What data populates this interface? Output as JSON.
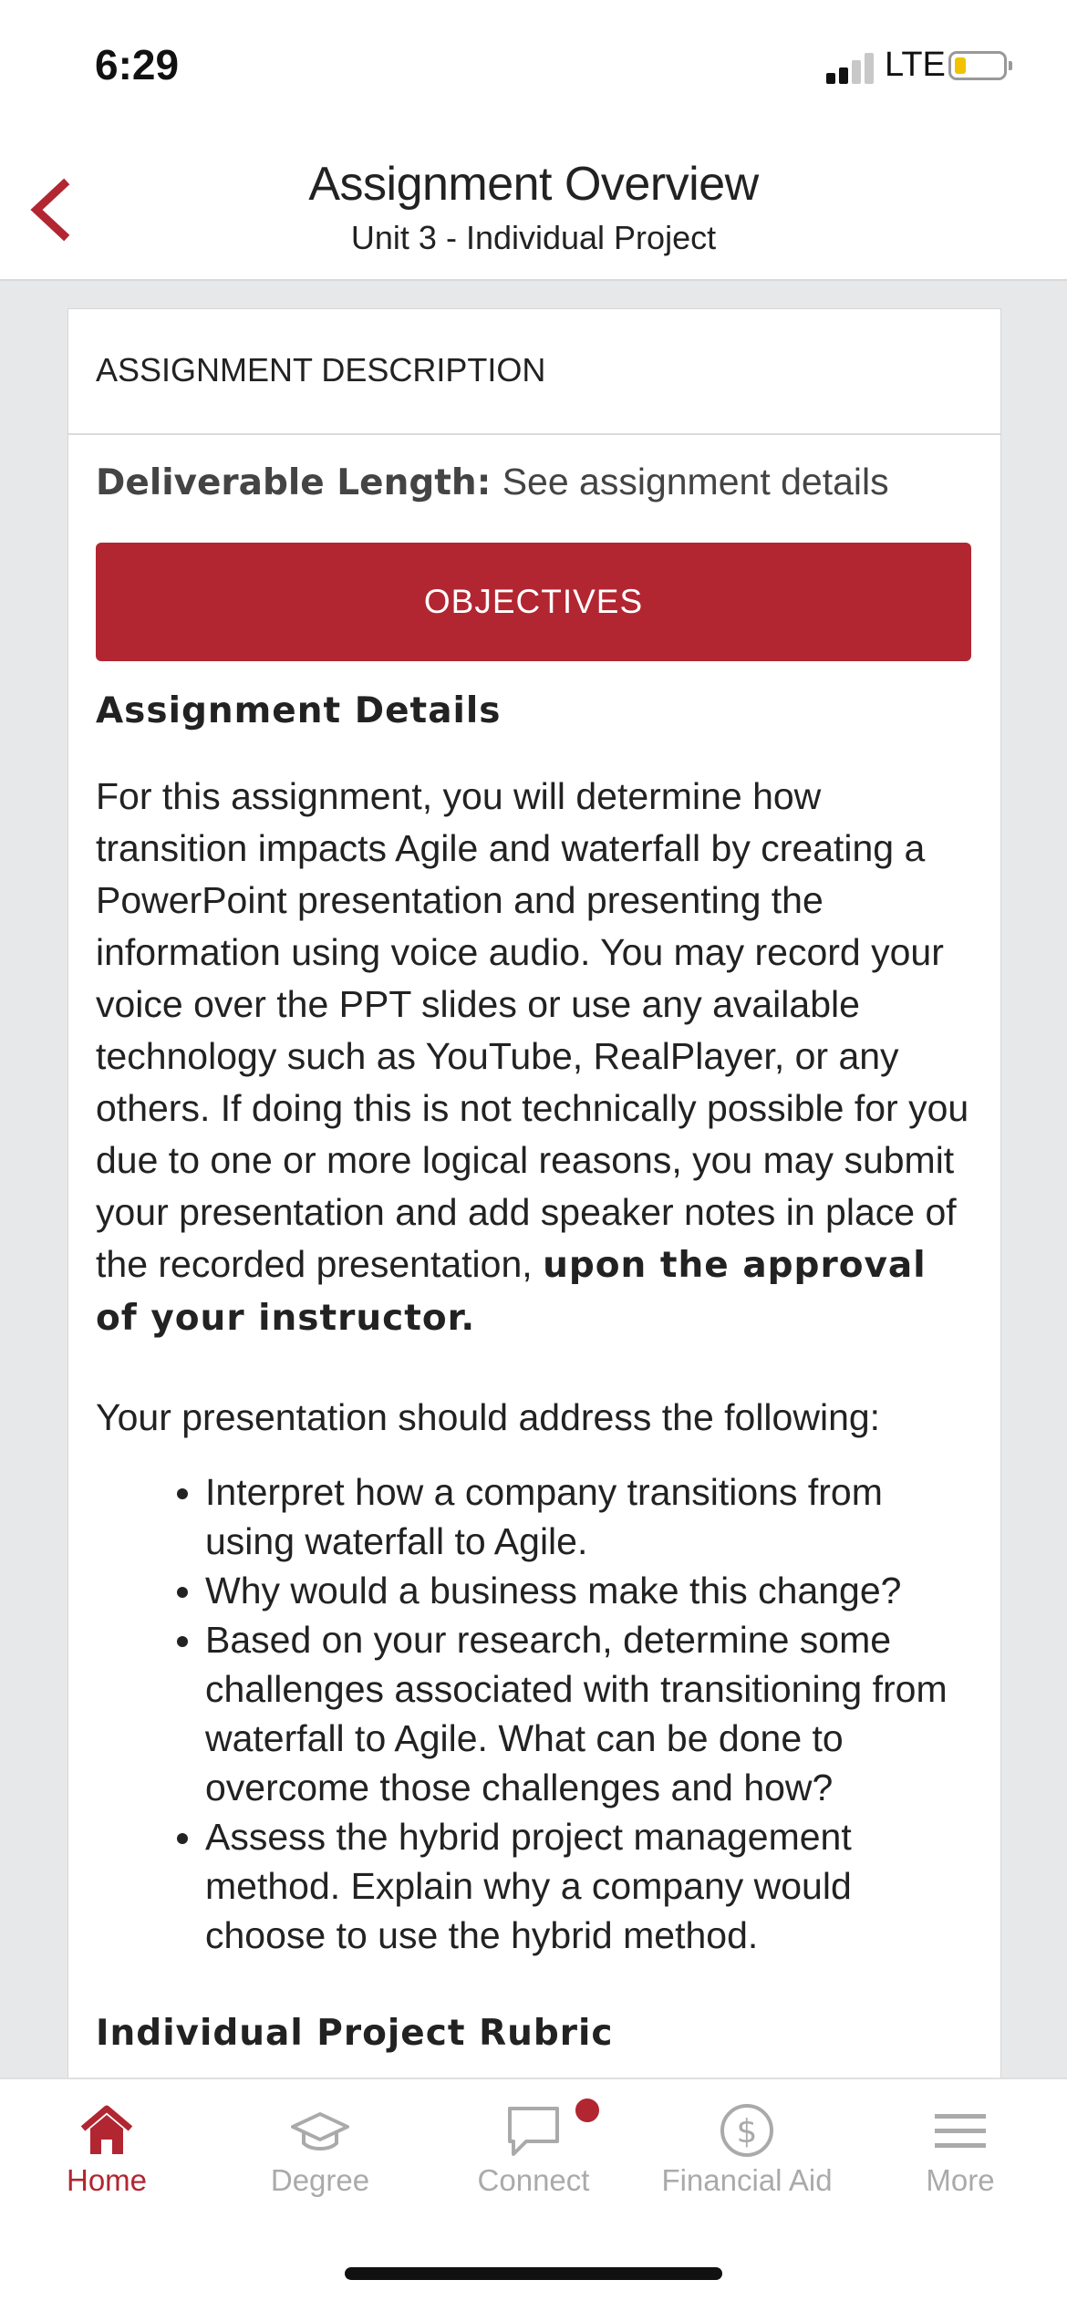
{
  "status_bar": {
    "time": "6:29",
    "network": "LTE",
    "signal_bars": 2,
    "battery_level": 0.15
  },
  "header": {
    "title": "Assignment Overview",
    "subtitle": "Unit 3 - Individual Project"
  },
  "card": {
    "section_label": "ASSIGNMENT DESCRIPTION",
    "deliverable_label": "Deliverable Length:",
    "deliverable_value": "See assignment details",
    "objectives_button": "OBJECTIVES",
    "details_title": "Assignment Details",
    "paragraph1": "For this assignment, you will determine how transition impacts Agile and waterfall by creating a PowerPoint presentation and presenting the information using voice audio. You may record your voice over the PPT slides or use any available technology such as YouTube, RealPlayer, or any others. If doing this is not technically possible for you due to one or more logical reasons, you may submit your presentation and add speaker notes in place of the recorded presentation,",
    "paragraph1_bold": "upon the approval of your instructor.",
    "paragraph2": "Your presentation should address the following:",
    "bullets": [
      "Interpret how a company transitions from using waterfall to Agile.",
      "Why would a business make this change?",
      "Based on your research, determine some challenges associated with transitioning from waterfall to Agile. What can be done to overcome those challenges and how?",
      "Assess the hybrid project management method. Explain why a company would choose to use the hybrid method."
    ],
    "rubric_title": "Individual Project Rubric"
  },
  "tabs": [
    {
      "label": "Home",
      "icon": "home-icon",
      "active": true
    },
    {
      "label": "Degree",
      "icon": "graduation-cap-icon",
      "active": false
    },
    {
      "label": "Connect",
      "icon": "chat-bubble-icon",
      "active": false,
      "badge": true
    },
    {
      "label": "Financial Aid",
      "icon": "dollar-circle-icon",
      "active": false
    },
    {
      "label": "More",
      "icon": "menu-icon",
      "active": false
    }
  ],
  "colors": {
    "accent": "#b22631",
    "tab_inactive": "#aaaaaa",
    "page_bg": "#e6e8e9"
  }
}
